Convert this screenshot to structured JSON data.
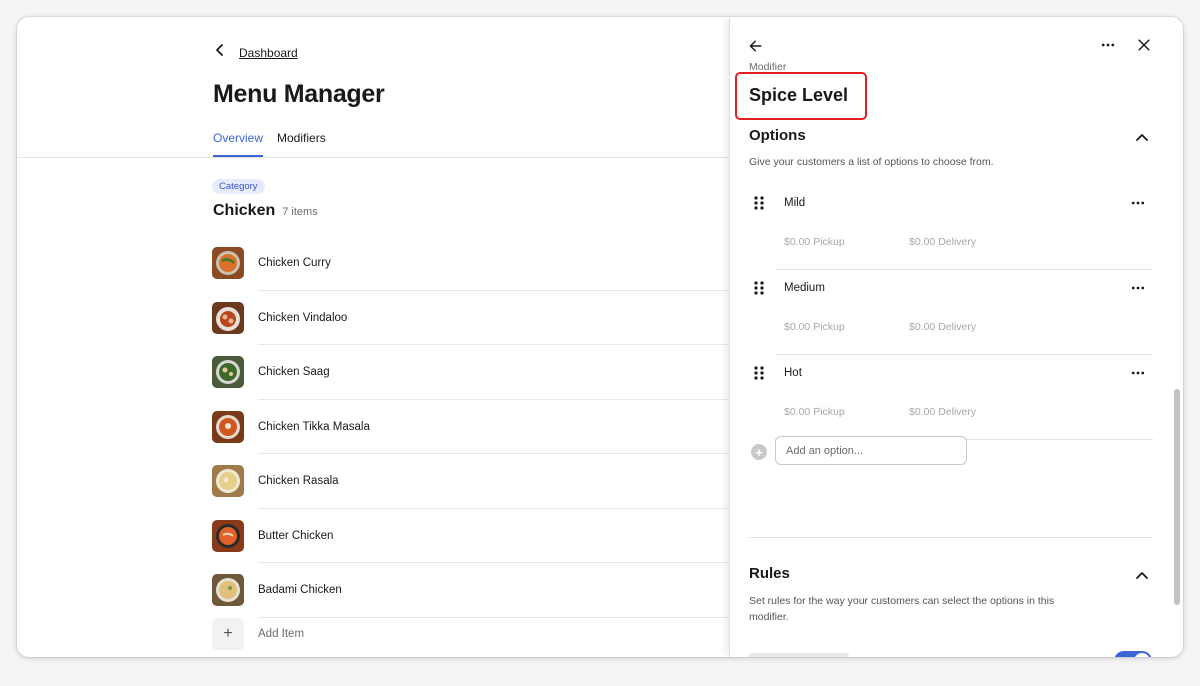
{
  "page": {
    "breadcrumb": "Dashboard",
    "title": "Menu Manager",
    "tabs": [
      {
        "label": "Overview",
        "active": true
      },
      {
        "label": "Modifiers",
        "active": false
      }
    ]
  },
  "category": {
    "badge": "Category",
    "name": "Chicken",
    "count": "7 items",
    "items": [
      {
        "name": "Chicken Curry"
      },
      {
        "name": "Chicken Vindaloo"
      },
      {
        "name": "Chicken Saag"
      },
      {
        "name": "Chicken Tikka Masala"
      },
      {
        "name": "Chicken Rasala"
      },
      {
        "name": "Butter Chicken"
      },
      {
        "name": "Badami Chicken"
      }
    ],
    "add_item": "Add Item"
  },
  "drawer": {
    "eyebrow": "Modifier",
    "title": "Spice Level",
    "options_section": {
      "title": "Options",
      "description": "Give your customers a list of options to choose from.",
      "options": [
        {
          "name": "Mild",
          "pickup": "$0.00 Pickup",
          "delivery": "$0.00 Delivery"
        },
        {
          "name": "Medium",
          "pickup": "$0.00 Pickup",
          "delivery": "$0.00 Delivery"
        },
        {
          "name": "Hot",
          "pickup": "$0.00 Pickup",
          "delivery": "$0.00 Delivery"
        }
      ],
      "add_placeholder": "Add an option..."
    },
    "rules_section": {
      "title": "Rules",
      "description": "Set rules for the way your customers can select the options in this modifier."
    }
  },
  "colors": {
    "accent": "#3b66d8",
    "highlight": "#e02020",
    "badge_bg": "#e7ecfd"
  },
  "icons": {
    "back": "chevron-left-icon",
    "drawer_back": "arrow-left-icon",
    "more": "more-horizontal-icon",
    "close": "close-icon",
    "collapse": "chevron-up-icon",
    "drag": "drag-handle-icon",
    "add": "plus-icon"
  }
}
